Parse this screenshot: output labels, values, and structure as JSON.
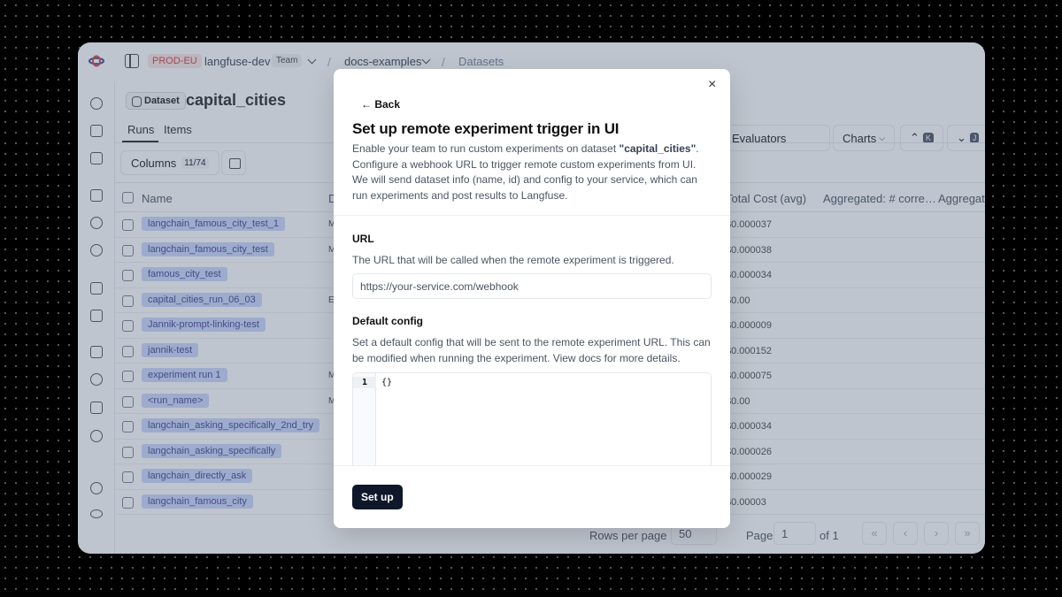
{
  "topbar": {
    "env_badge": "PROD-EU",
    "org": "langfuse-dev",
    "org_badge": "Team",
    "project": "docs-examples",
    "breadcrumb_current": "Datasets"
  },
  "dataset": {
    "badge": "Dataset",
    "title": "capital_cities"
  },
  "tabs": [
    {
      "label": "Runs"
    },
    {
      "label": "Items"
    }
  ],
  "toolbar": {
    "columns_label": "Columns",
    "columns_count": "11/74",
    "evaluators_label": "Evaluators",
    "charts_label": "Charts",
    "kbd_up": "K",
    "kbd_down": "J"
  },
  "table": {
    "headers": [
      "Name",
      "D",
      "Total Cost (avg)",
      "Aggregated: # corre…",
      "Aggregat"
    ],
    "rows": [
      {
        "name": "langchain_famous_city_test_1",
        "d": "M",
        "cost": "$0.000037"
      },
      {
        "name": "langchain_famous_city_test",
        "d": "M",
        "cost": "$0.000038"
      },
      {
        "name": "famous_city_test",
        "d": "",
        "cost": "$0.000034"
      },
      {
        "name": "capital_cities_run_06_03",
        "d": "E",
        "cost": "$0.00"
      },
      {
        "name": "Jannik-prompt-linking-test",
        "d": "",
        "cost": "$0.000009"
      },
      {
        "name": "jannik-test",
        "d": "",
        "cost": "$0.000152"
      },
      {
        "name": "experiment run 1",
        "d": "M",
        "cost": "$0.000075"
      },
      {
        "name": "<run_name>",
        "d": "M",
        "cost": "$0.00"
      },
      {
        "name": "langchain_asking_specifically_2nd_try",
        "d": "",
        "cost": "$0.000034"
      },
      {
        "name": "langchain_asking_specifically",
        "d": "",
        "cost": "$0.000026"
      },
      {
        "name": "langchain_directly_ask",
        "d": "",
        "cost": "$0.000029"
      },
      {
        "name": "langchain_famous_city",
        "d": "",
        "cost": "$0.00003"
      }
    ]
  },
  "footer": {
    "rows_per_page_label": "Rows per page",
    "rows_per_page_value": "50",
    "page_label": "Page",
    "page_value": "1",
    "page_total": "of 1",
    "first": "«",
    "prev": "‹",
    "next": "›",
    "last": "»"
  },
  "modal": {
    "close": "×",
    "back_label": "← Back",
    "title": "Set up remote experiment trigger in UI",
    "desc_prefix": "Enable your team to run custom experiments on dataset ",
    "desc_dataset": "\"capital_cities\"",
    "desc_suffix": ". Configure a webhook URL to trigger remote custom experiments from UI. We will send dataset info (name, id) and config to your service, which can run experiments and post results to Langfuse.",
    "url_label": "URL",
    "url_help": "The URL that will be called when the remote experiment is triggered.",
    "url_placeholder": "https://your-service.com/webhook",
    "config_label": "Default config",
    "config_help": "Set a default config that will be sent to the remote experiment URL. This can be modified when running the experiment. View docs for more details.",
    "editor_line": "1",
    "editor_code": "{}",
    "submit_label": "Set up"
  }
}
